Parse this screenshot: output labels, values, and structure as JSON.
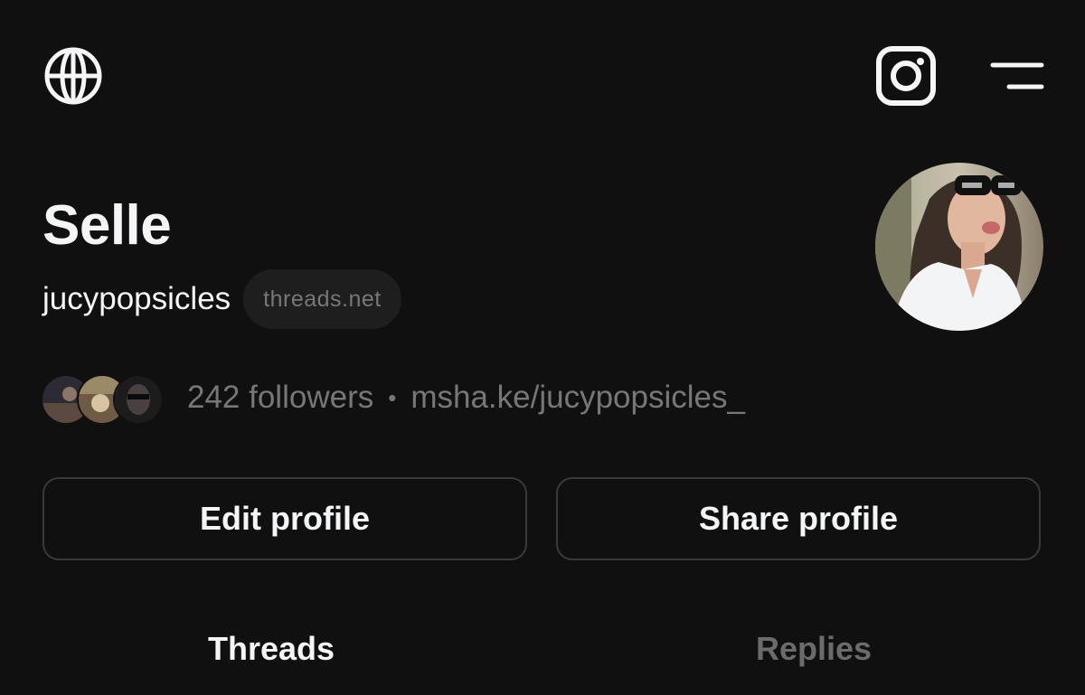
{
  "profile": {
    "name": "Selle",
    "handle": "jucypopsicles",
    "domain": "threads.net",
    "followers": "242 followers",
    "separator": "•",
    "link": "msha.ke/jucypopsicles_"
  },
  "actions": {
    "edit": "Edit profile",
    "share": "Share profile"
  },
  "tabs": [
    {
      "label": "Threads",
      "active": true
    },
    {
      "label": "Replies",
      "active": false
    }
  ],
  "icons": {
    "top_left": "globe-icon",
    "top_right_1": "instagram-icon",
    "top_right_2": "menu-icon"
  },
  "colors": {
    "background": "#101010",
    "text": "#f3f5f7",
    "muted": "#777777",
    "border": "#3a3a3a"
  }
}
